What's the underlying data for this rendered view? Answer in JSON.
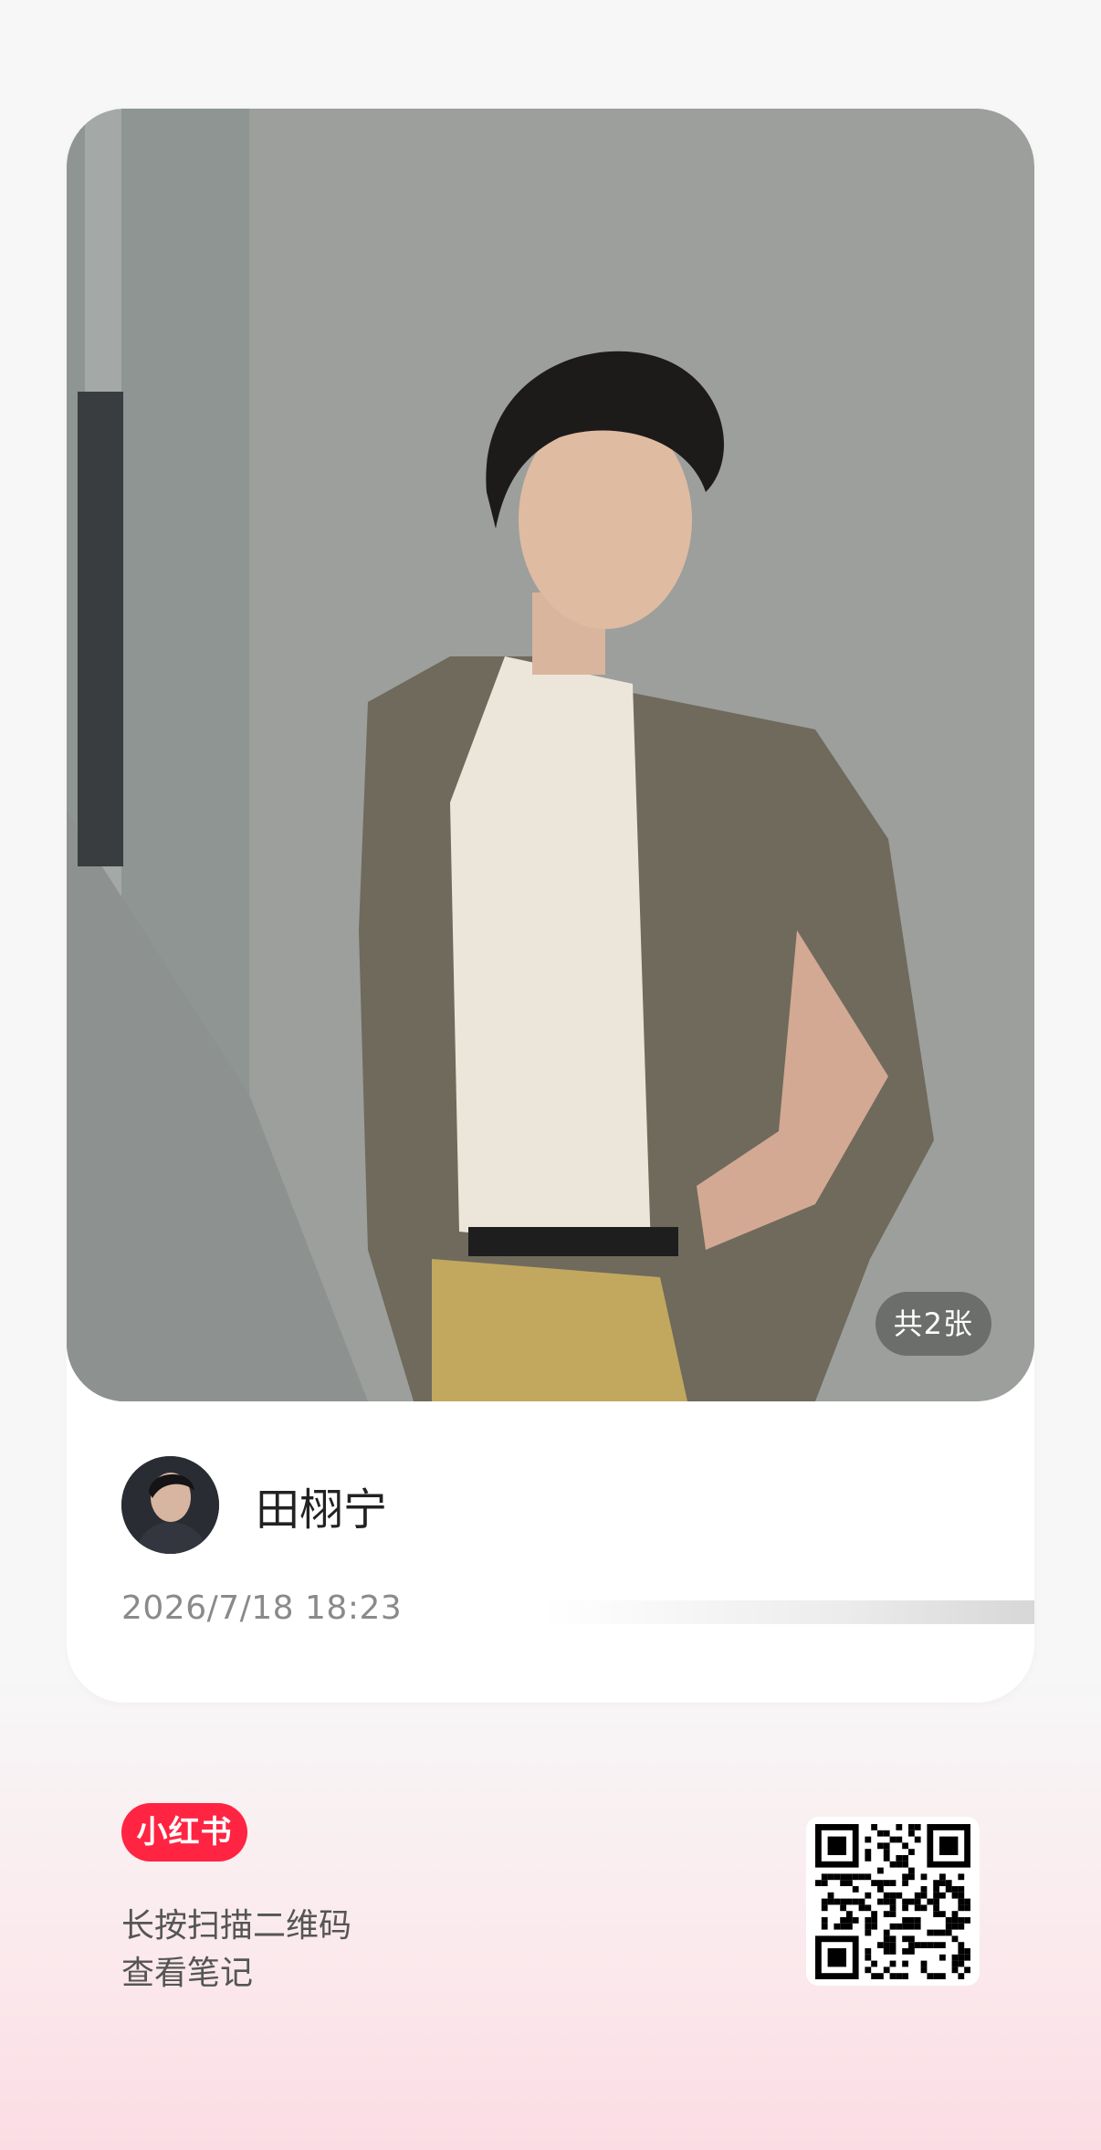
{
  "post": {
    "image_count_label": "共2张",
    "author_name": "田栩宁",
    "date": "2026/7/18 18:23"
  },
  "footer": {
    "brand": "小红书",
    "line1": "长按扫描二维码",
    "line2": "查看笔记"
  },
  "colors": {
    "brand": "#ff2442",
    "card": "#ffffff",
    "background": "#f7f7f7"
  }
}
